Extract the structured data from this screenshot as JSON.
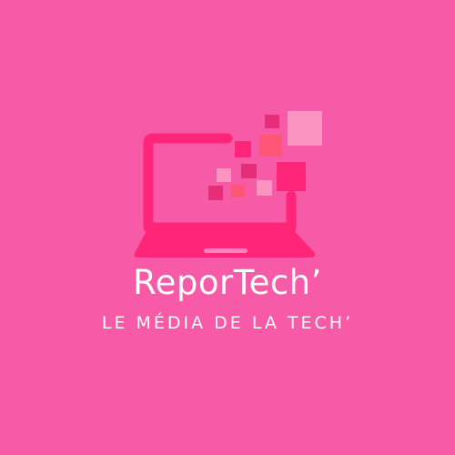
{
  "brand": {
    "name": "ReporTech’",
    "tagline": "LE MÉDIA DE LA TECH’"
  },
  "colors": {
    "background": "#f75aa6",
    "laptop": "#ff2578",
    "text": "#ffffff"
  },
  "icons": {
    "logo": "laptop-with-pixels-icon"
  }
}
